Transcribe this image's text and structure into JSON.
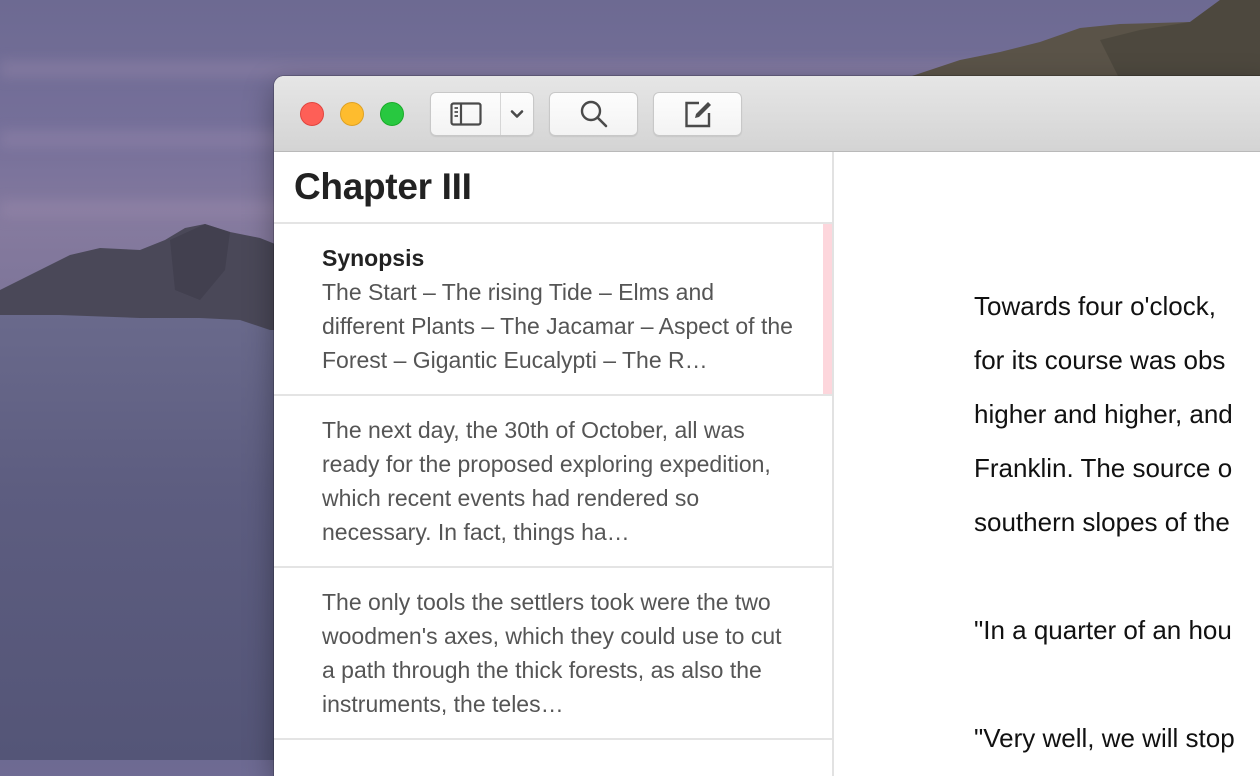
{
  "window": {
    "controls": {
      "close_label": "Close",
      "minimize_label": "Minimize",
      "zoom_label": "Zoom"
    }
  },
  "toolbar": {
    "sidebar_toggle_icon": "sidebar-icon",
    "sidebar_menu_icon": "chevron-down-icon",
    "search_icon": "magnifying-glass-icon",
    "compose_icon": "compose-icon"
  },
  "sidebar": {
    "title": "Chapter III",
    "notes": [
      {
        "title": "Synopsis",
        "body": "The Start – The rising Tide – Elms and different Plants – The Jacamar – Aspect of the Forest – Gigantic Eucalypti – The R…",
        "selected": true,
        "marker_color": "#fdd6dc"
      },
      {
        "title": "",
        "body": "The next day, the 30th of October, all was ready for the proposed exploring expedition, which recent events had rendered so necessary. In fact, things ha…",
        "selected": false
      },
      {
        "title": "",
        "body": "The only tools the settlers took were the two woodmen's axes, which they could use to cut a path through the thick forests, as also the instruments, the teles…",
        "selected": false
      }
    ]
  },
  "editor": {
    "paragraphs": [
      [
        "Towards four o'clock,",
        "for its course was obs",
        "higher and higher, and",
        "Franklin. The source o",
        "southern slopes of the"
      ],
      [
        "\"In a quarter of an hou"
      ],
      [
        "\"Very well, we will stop"
      ]
    ]
  },
  "colors": {
    "close": "#fe5f57",
    "minimize": "#febc2e",
    "zoom": "#28c840",
    "selected_marker": "#fdd6dc"
  }
}
